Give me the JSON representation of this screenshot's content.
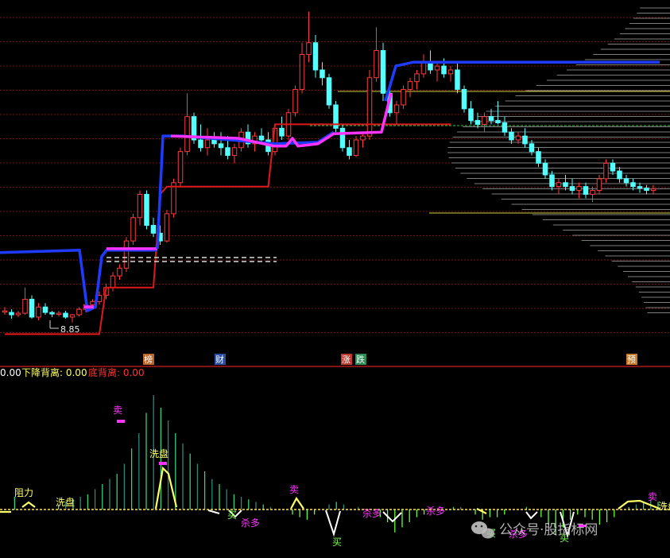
{
  "chart_data": [
    {
      "type": "candlestick",
      "panel": "price",
      "price_label": "8.85",
      "candles": [
        {
          "o": 9.0,
          "h": 9.05,
          "l": 8.95,
          "c": 9.0
        },
        {
          "o": 8.98,
          "h": 9.02,
          "l": 8.9,
          "c": 8.95
        },
        {
          "o": 8.95,
          "h": 9.0,
          "l": 8.92,
          "c": 8.97
        },
        {
          "o": 8.97,
          "h": 9.3,
          "l": 8.95,
          "c": 9.15
        },
        {
          "o": 9.15,
          "h": 9.2,
          "l": 8.9,
          "c": 8.92
        },
        {
          "o": 8.92,
          "h": 9.1,
          "l": 8.88,
          "c": 9.05
        },
        {
          "o": 9.05,
          "h": 9.1,
          "l": 8.95,
          "c": 8.98
        },
        {
          "o": 8.98,
          "h": 9.0,
          "l": 8.92,
          "c": 8.96
        },
        {
          "o": 8.96,
          "h": 9.0,
          "l": 8.93,
          "c": 8.97
        },
        {
          "o": 8.97,
          "h": 9.0,
          "l": 8.9,
          "c": 8.92
        },
        {
          "o": 8.92,
          "h": 8.96,
          "l": 8.85,
          "c": 8.95
        },
        {
          "o": 8.95,
          "h": 9.05,
          "l": 8.93,
          "c": 9.02
        },
        {
          "o": 9.02,
          "h": 9.1,
          "l": 8.98,
          "c": 9.08
        },
        {
          "o": 9.08,
          "h": 9.15,
          "l": 9.05,
          "c": 9.12
        },
        {
          "o": 9.12,
          "h": 9.25,
          "l": 9.08,
          "c": 9.2
        },
        {
          "o": 9.2,
          "h": 9.35,
          "l": 9.15,
          "c": 9.3
        },
        {
          "o": 9.3,
          "h": 9.5,
          "l": 9.25,
          "c": 9.45
        },
        {
          "o": 9.45,
          "h": 9.6,
          "l": 9.4,
          "c": 9.55
        },
        {
          "o": 9.55,
          "h": 9.95,
          "l": 9.5,
          "c": 9.9
        },
        {
          "o": 9.9,
          "h": 10.25,
          "l": 9.85,
          "c": 10.2
        },
        {
          "o": 10.2,
          "h": 10.55,
          "l": 10.1,
          "c": 10.5
        },
        {
          "o": 10.5,
          "h": 10.55,
          "l": 10.05,
          "c": 10.1
        },
        {
          "o": 10.1,
          "h": 10.2,
          "l": 9.95,
          "c": 10.0
        },
        {
          "o": 10.0,
          "h": 10.1,
          "l": 9.85,
          "c": 9.9
        },
        {
          "o": 9.9,
          "h": 10.3,
          "l": 9.88,
          "c": 10.25
        },
        {
          "o": 10.25,
          "h": 10.7,
          "l": 10.2,
          "c": 10.65
        },
        {
          "o": 10.65,
          "h": 11.1,
          "l": 10.6,
          "c": 11.05
        },
        {
          "o": 11.05,
          "h": 11.8,
          "l": 11.0,
          "c": 11.5
        },
        {
          "o": 11.5,
          "h": 11.55,
          "l": 11.15,
          "c": 11.2
        },
        {
          "o": 11.2,
          "h": 11.4,
          "l": 11.05,
          "c": 11.1
        },
        {
          "o": 11.1,
          "h": 11.35,
          "l": 11.0,
          "c": 11.2
        },
        {
          "o": 11.2,
          "h": 11.3,
          "l": 11.1,
          "c": 11.15
        },
        {
          "o": 11.15,
          "h": 11.3,
          "l": 11.0,
          "c": 11.1
        },
        {
          "o": 11.1,
          "h": 11.25,
          "l": 10.95,
          "c": 11.0
        },
        {
          "o": 11.0,
          "h": 11.15,
          "l": 10.9,
          "c": 11.1
        },
        {
          "o": 11.1,
          "h": 11.35,
          "l": 11.05,
          "c": 11.3
        },
        {
          "o": 11.3,
          "h": 11.4,
          "l": 11.1,
          "c": 11.15
        },
        {
          "o": 11.15,
          "h": 11.3,
          "l": 11.05,
          "c": 11.25
        },
        {
          "o": 11.25,
          "h": 11.35,
          "l": 11.15,
          "c": 11.2
        },
        {
          "o": 11.2,
          "h": 11.3,
          "l": 11.0,
          "c": 11.05
        },
        {
          "o": 11.05,
          "h": 11.4,
          "l": 11.0,
          "c": 11.35
        },
        {
          "o": 11.35,
          "h": 11.5,
          "l": 11.2,
          "c": 11.25
        },
        {
          "o": 11.25,
          "h": 11.6,
          "l": 11.2,
          "c": 11.55
        },
        {
          "o": 11.55,
          "h": 11.9,
          "l": 11.5,
          "c": 11.85
        },
        {
          "o": 11.85,
          "h": 12.45,
          "l": 11.8,
          "c": 12.3
        },
        {
          "o": 12.3,
          "h": 12.85,
          "l": 12.2,
          "c": 12.45
        },
        {
          "o": 12.45,
          "h": 12.55,
          "l": 12.0,
          "c": 12.1
        },
        {
          "o": 12.1,
          "h": 12.2,
          "l": 11.9,
          "c": 12.0
        },
        {
          "o": 12.0,
          "h": 12.05,
          "l": 11.6,
          "c": 11.65
        },
        {
          "o": 11.65,
          "h": 11.7,
          "l": 11.3,
          "c": 11.35
        },
        {
          "o": 11.35,
          "h": 11.4,
          "l": 11.05,
          "c": 11.1
        },
        {
          "o": 11.1,
          "h": 11.2,
          "l": 10.95,
          "c": 11.0
        },
        {
          "o": 11.0,
          "h": 11.25,
          "l": 10.98,
          "c": 11.2
        },
        {
          "o": 11.2,
          "h": 11.3,
          "l": 11.1,
          "c": 11.25
        },
        {
          "o": 11.25,
          "h": 12.1,
          "l": 11.2,
          "c": 12.0
        },
        {
          "o": 12.0,
          "h": 12.65,
          "l": 11.95,
          "c": 12.35
        },
        {
          "o": 12.35,
          "h": 12.45,
          "l": 11.7,
          "c": 11.8
        },
        {
          "o": 11.8,
          "h": 11.85,
          "l": 11.5,
          "c": 11.55
        },
        {
          "o": 11.55,
          "h": 11.7,
          "l": 11.4,
          "c": 11.65
        },
        {
          "o": 11.65,
          "h": 11.9,
          "l": 11.6,
          "c": 11.85
        },
        {
          "o": 11.85,
          "h": 12.0,
          "l": 11.75,
          "c": 11.95
        },
        {
          "o": 11.95,
          "h": 12.1,
          "l": 11.85,
          "c": 12.05
        },
        {
          "o": 12.05,
          "h": 12.3,
          "l": 12.0,
          "c": 12.2
        },
        {
          "o": 12.2,
          "h": 12.35,
          "l": 12.05,
          "c": 12.1
        },
        {
          "o": 12.1,
          "h": 12.2,
          "l": 11.95,
          "c": 12.15
        },
        {
          "o": 12.15,
          "h": 12.25,
          "l": 12.0,
          "c": 12.05
        },
        {
          "o": 12.05,
          "h": 12.15,
          "l": 11.95,
          "c": 12.1
        },
        {
          "o": 12.1,
          "h": 12.2,
          "l": 11.8,
          "c": 11.85
        },
        {
          "o": 11.85,
          "h": 11.9,
          "l": 11.55,
          "c": 11.6
        },
        {
          "o": 11.6,
          "h": 11.7,
          "l": 11.4,
          "c": 11.45
        },
        {
          "o": 11.45,
          "h": 11.55,
          "l": 11.35,
          "c": 11.4
        },
        {
          "o": 11.4,
          "h": 11.55,
          "l": 11.3,
          "c": 11.5
        },
        {
          "o": 11.5,
          "h": 11.6,
          "l": 11.4,
          "c": 11.45
        },
        {
          "o": 11.45,
          "h": 11.7,
          "l": 11.4,
          "c": 11.42
        },
        {
          "o": 11.42,
          "h": 11.5,
          "l": 11.25,
          "c": 11.3
        },
        {
          "o": 11.3,
          "h": 11.35,
          "l": 11.15,
          "c": 11.2
        },
        {
          "o": 11.2,
          "h": 11.3,
          "l": 11.15,
          "c": 11.25
        },
        {
          "o": 11.25,
          "h": 11.35,
          "l": 11.1,
          "c": 11.15
        },
        {
          "o": 11.15,
          "h": 11.2,
          "l": 11.0,
          "c": 11.05
        },
        {
          "o": 11.05,
          "h": 11.1,
          "l": 10.85,
          "c": 10.9
        },
        {
          "o": 10.9,
          "h": 10.95,
          "l": 10.7,
          "c": 10.75
        },
        {
          "o": 10.75,
          "h": 10.8,
          "l": 10.55,
          "c": 10.6
        },
        {
          "o": 10.6,
          "h": 10.7,
          "l": 10.5,
          "c": 10.65
        },
        {
          "o": 10.65,
          "h": 10.75,
          "l": 10.55,
          "c": 10.6
        },
        {
          "o": 10.6,
          "h": 10.7,
          "l": 10.5,
          "c": 10.55
        },
        {
          "o": 10.55,
          "h": 10.65,
          "l": 10.45,
          "c": 10.6
        },
        {
          "o": 10.6,
          "h": 10.65,
          "l": 10.45,
          "c": 10.5
        },
        {
          "o": 10.5,
          "h": 10.6,
          "l": 10.4,
          "c": 10.55
        },
        {
          "o": 10.55,
          "h": 10.75,
          "l": 10.5,
          "c": 10.7
        },
        {
          "o": 10.7,
          "h": 10.95,
          "l": 10.65,
          "c": 10.9
        },
        {
          "o": 10.9,
          "h": 10.95,
          "l": 10.75,
          "c": 10.8
        },
        {
          "o": 10.8,
          "h": 10.85,
          "l": 10.65,
          "c": 10.7
        },
        {
          "o": 10.7,
          "h": 10.75,
          "l": 10.6,
          "c": 10.65
        },
        {
          "o": 10.65,
          "h": 10.7,
          "l": 10.55,
          "c": 10.6
        },
        {
          "o": 10.6,
          "h": 10.65,
          "l": 10.52,
          "c": 10.58
        },
        {
          "o": 10.58,
          "h": 10.62,
          "l": 10.5,
          "c": 10.55
        },
        {
          "o": 10.55,
          "h": 10.62,
          "l": 10.5,
          "c": 10.57
        }
      ],
      "event_markers": [
        {
          "label": "榜",
          "bg": "#b8662a",
          "fg": "#ffffff"
        },
        {
          "label": "财",
          "bg": "#2b4f9e",
          "fg": "#ffffff"
        },
        {
          "label": "涨",
          "bg": "#c0392b",
          "fg": "#ffffff"
        },
        {
          "label": "跌",
          "bg": "#2e8b57",
          "fg": "#ffffff"
        },
        {
          "label": "预",
          "bg": "#c77a2a",
          "fg": "#ffffff"
        }
      ],
      "colors": {
        "up": "#ff3b3b",
        "down": "#54ffff",
        "support": "#e01818",
        "trend_low": "#1f3bff",
        "trend_high": "#ff33ff",
        "gridline": "#7a1212"
      }
    },
    {
      "type": "histogram",
      "panel": "indicator",
      "legend": [
        {
          "text": "0.00",
          "color": "#ffffff"
        },
        {
          "text": "下降背离: 0.00",
          "color": "#ffff66"
        },
        {
          "text": "底背离: 0.00",
          "color": "#ff3333"
        }
      ],
      "signals": [
        {
          "text": "阻力",
          "color": "#ffff66"
        },
        {
          "text": "洗盘",
          "color": "#ffff66"
        },
        {
          "text": "卖",
          "color": "#ff33ff"
        },
        {
          "text": "洗盘",
          "color": "#ffff66"
        },
        {
          "text": "卖",
          "color": "#ff33ff"
        },
        {
          "text": "买",
          "color": "#7cff4a"
        },
        {
          "text": "杀多",
          "color": "#ff33ff"
        },
        {
          "text": "买",
          "color": "#7cff4a"
        },
        {
          "text": "杀多",
          "color": "#ff33ff"
        },
        {
          "text": "杀多",
          "color": "#ff33ff"
        },
        {
          "text": "买",
          "color": "#7cff4a"
        },
        {
          "text": "杀多",
          "color": "#ff33ff"
        },
        {
          "text": "买",
          "color": "#7cff4a"
        },
        {
          "text": "卖",
          "color": "#ff33ff"
        },
        {
          "text": "洗盘",
          "color": "#ffff66"
        }
      ],
      "values": [
        0,
        0,
        0.5,
        0,
        0,
        0,
        0,
        0,
        0.2,
        0.3,
        0.4,
        0.5,
        0.6,
        0.8,
        1,
        1.2,
        1.4,
        1.8,
        2.4,
        3.0,
        3.8,
        4.5,
        4.0,
        3.5,
        3.0,
        2.6,
        2.2,
        1.8,
        1.5,
        1.2,
        1.0,
        0.8,
        0.6,
        0.5,
        0.4,
        0.3,
        0.2,
        0.1,
        0,
        0,
        -0.2,
        -0.3,
        -0.4,
        -0.2,
        0,
        0.2,
        0.3,
        0.2,
        0,
        0.1,
        0,
        0,
        -0.3,
        -0.5,
        -0.9,
        -0.7,
        -0.5,
        -0.3,
        -0.2,
        0,
        0,
        0,
        0.1,
        0.1,
        0,
        -0.2,
        -0.4,
        -0.3,
        -0.3,
        -0.2,
        0,
        0,
        0.1,
        0,
        -0.3,
        -0.6,
        -1.0,
        -0.7,
        -0.4,
        -0.2,
        -0.3,
        -0.4,
        -0.6,
        -0.5,
        -0.3,
        0,
        0.1,
        0.2,
        0.3,
        0.4,
        0.3,
        0.2
      ],
      "colors": {
        "pos_a": "#2a8a7a",
        "pos_b": "#38d07a",
        "neg": "#64ff34",
        "zero_line": "#ffe14a",
        "signal_line": "#ffff66",
        "neg_line": "#ffffff"
      }
    }
  ],
  "watermark": "公众号·股指标网",
  "watermark_icon": "wechat-icon"
}
